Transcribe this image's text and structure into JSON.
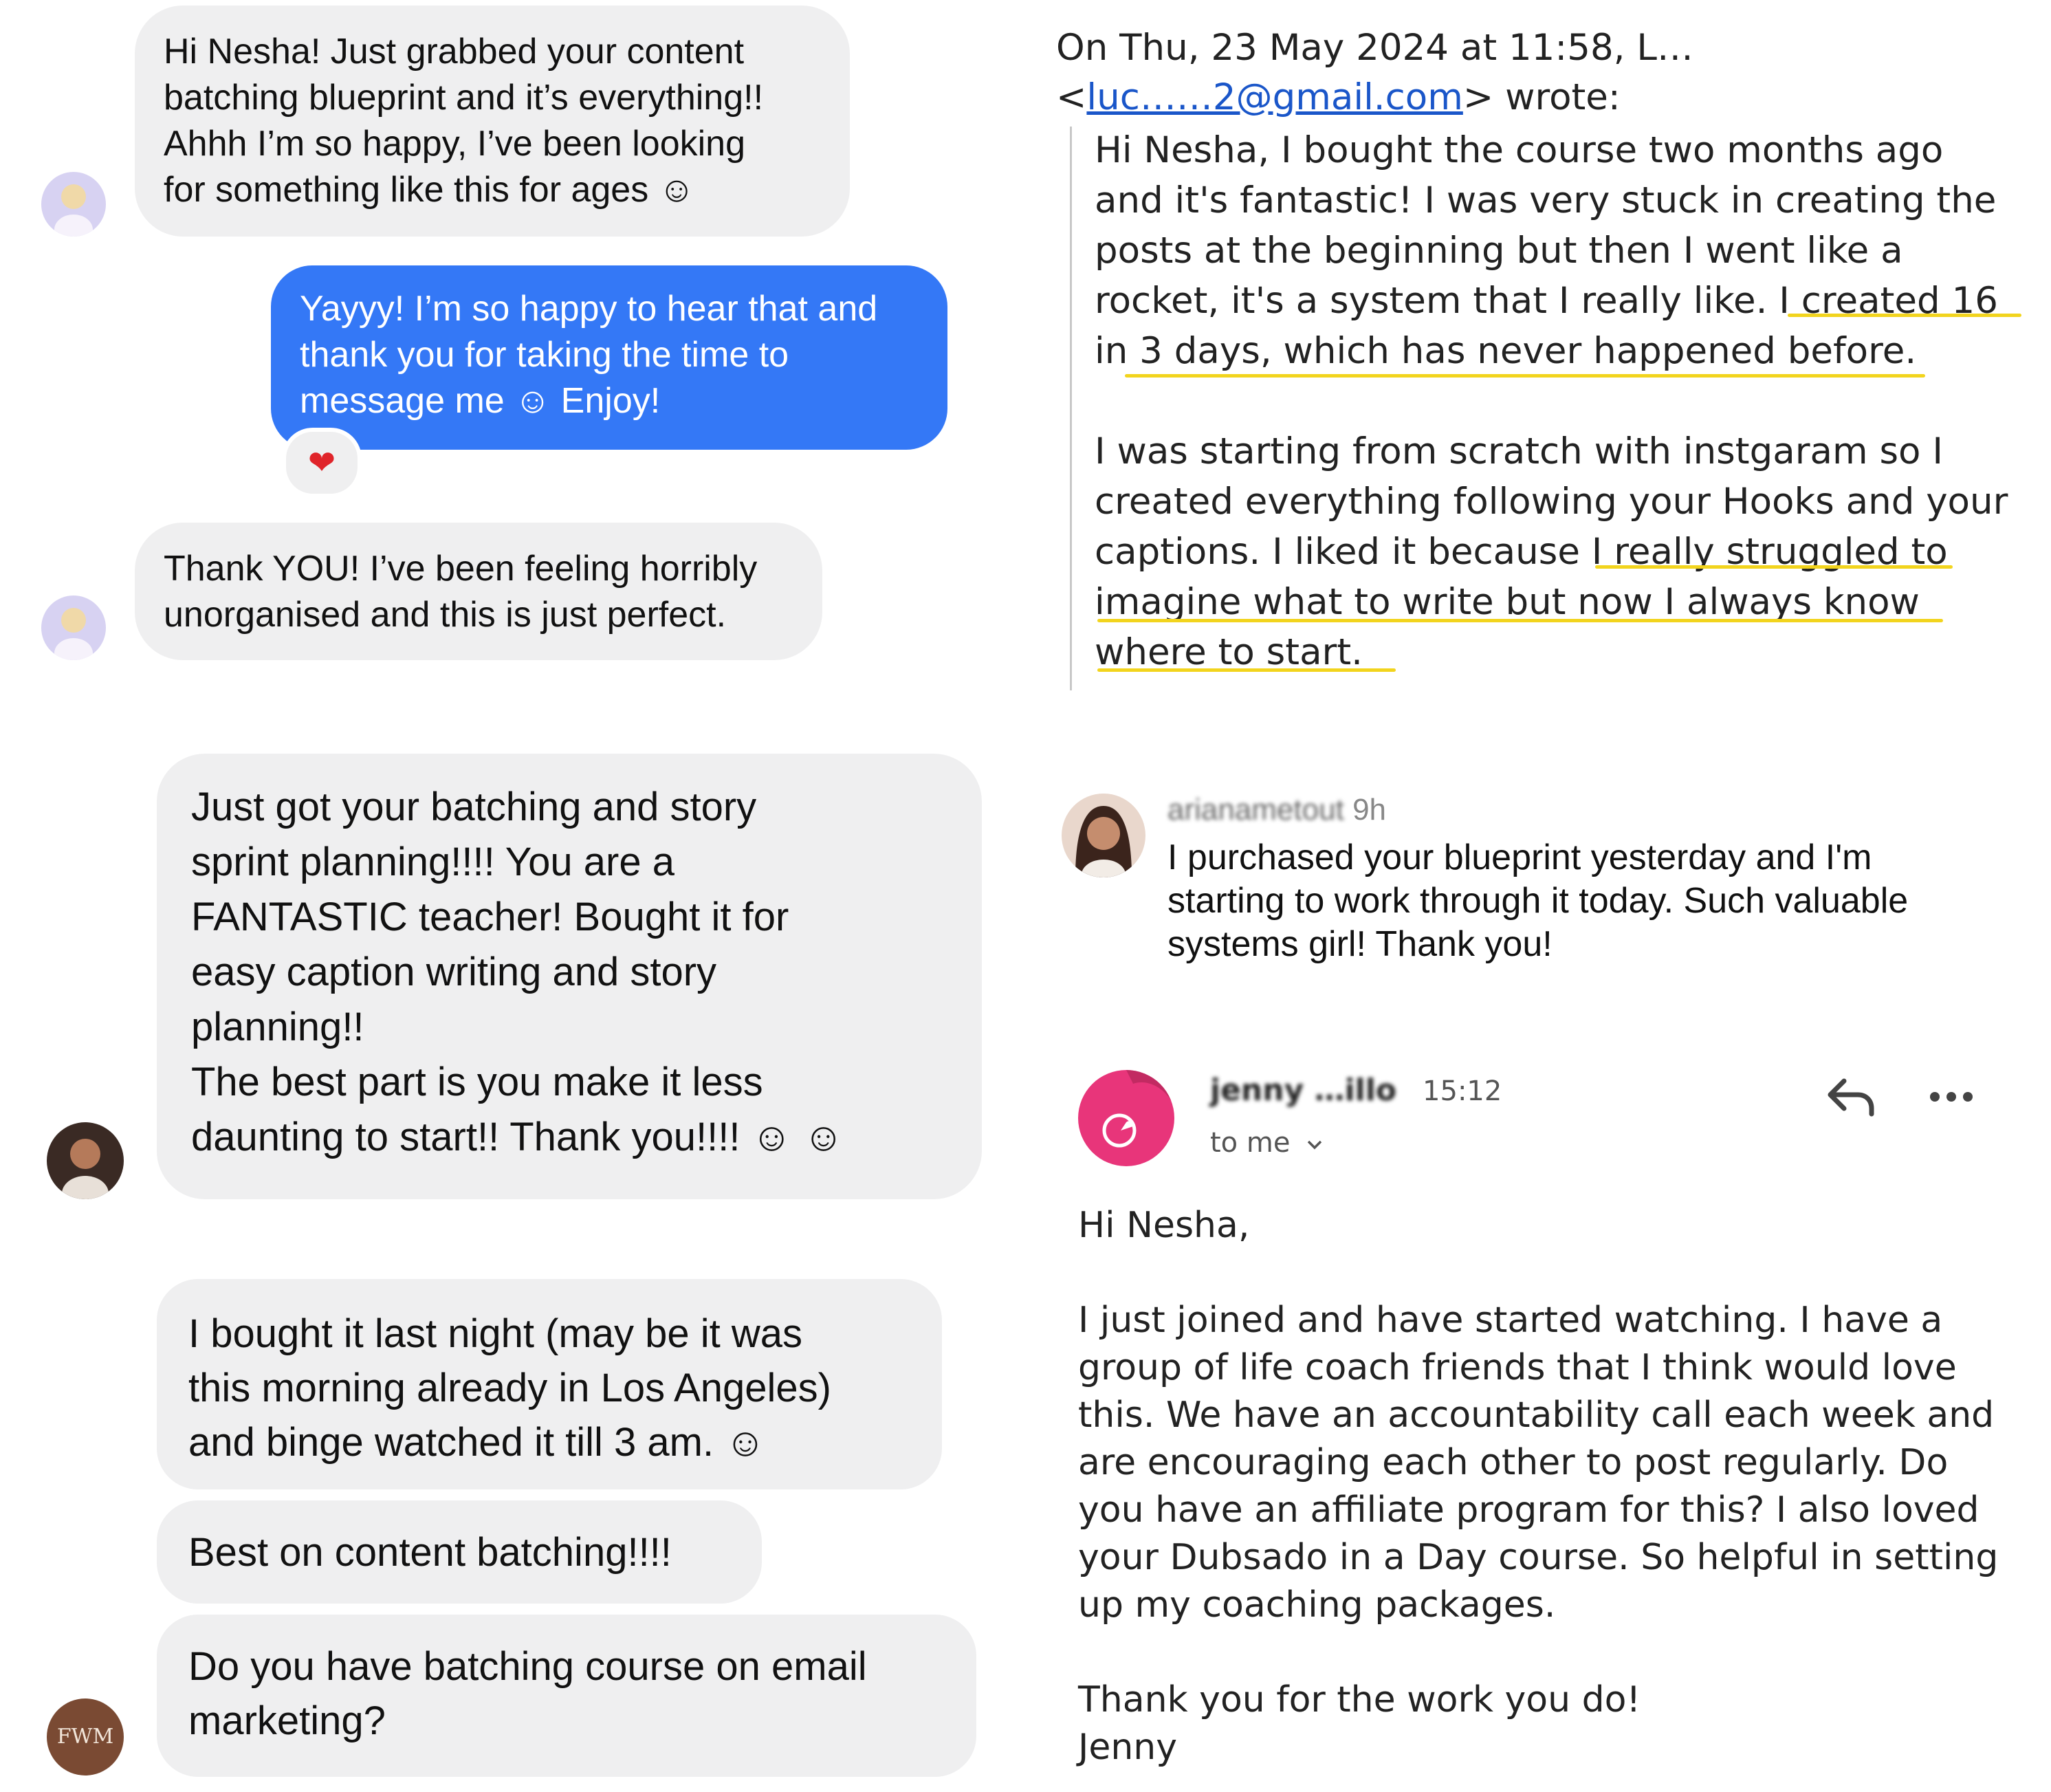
{
  "chat1": {
    "bubble1_lines": [
      "Hi Nesha! Just grabbed your content",
      "batching blueprint and it’s everything!!",
      "Ahhh I’m so happy, I’ve been looking",
      "for something like this for ages ☺"
    ],
    "reply_lines": [
      "Yayyy! I’m so happy to hear that and",
      "thank you for taking the time to",
      "message me ☺ Enjoy!"
    ],
    "reaction": "❤",
    "bubble2_lines": [
      "Thank YOU! I’ve been feeling horribly",
      "unorganised and this is just perfect."
    ]
  },
  "email1": {
    "header_line1": "On Thu, 23 May 2024 at 11:58, L…",
    "header_line2_prefix": "<",
    "header_email": "luc……2@gmail.com",
    "header_line2_suffix": "> wrote:",
    "para1_lines": [
      "Hi Nesha, I bought the course two months ago",
      "and it's fantastic! I was very stuck in creating the",
      "posts at the beginning but then I went like a",
      "rocket, it's a system that I really like. I created 16",
      "in 3 days, which has never happened before."
    ],
    "para2_lines": [
      "I was starting from scratch with instgaram so I",
      "created everything following your Hooks and your",
      "captions. I liked it because I really struggled to",
      "imagine what to write but now I always know",
      "where to start."
    ]
  },
  "chat2": {
    "lines": [
      "Just got your batching and story",
      "sprint planning!!!! You are a",
      "FANTASTIC teacher! Bought it for",
      "easy caption writing and story",
      "planning!!",
      "The best part is you make it less",
      "daunting to start!! Thank you!!!! ☺ ☺"
    ]
  },
  "comment": {
    "username": "arianametout",
    "time": "9h",
    "lines": [
      "I purchased your blueprint yesterday and I'm",
      "starting to work through it today. Such valuable",
      "systems girl! Thank you!"
    ]
  },
  "chat3": {
    "bubble1_lines": [
      "I bought it last night (may be it was",
      "this morning already in Los Angeles)",
      "and binge watched it till 3 am. ☺"
    ],
    "bubble2": "Best on content batching!!!!",
    "bubble3_lines": [
      "Do you have batching course on email",
      "marketing?"
    ],
    "avatar_logo": "FWM"
  },
  "email2": {
    "sender": "jenny …illo",
    "time": "15:12",
    "to_label": "to me",
    "greeting": "Hi Nesha,",
    "body_lines": [
      "I just joined and have started watching. I have a",
      "group of life coach friends that I think would love",
      "this. We have an accountability call each week and",
      "are encouraging each other to post regularly. Do",
      "you have an affiliate program for this? I also loved",
      "your Dubsado in a Day course. So helpful in setting",
      "up my coaching packages."
    ],
    "thanks": "Thank you for the work you do!",
    "signature": "Jenny"
  },
  "colors": {
    "bubble_gray": "#efeff0",
    "sent_blue": "#3478f6",
    "highlight_yellow": "#f2d41d",
    "link_blue": "#1a56c9"
  }
}
